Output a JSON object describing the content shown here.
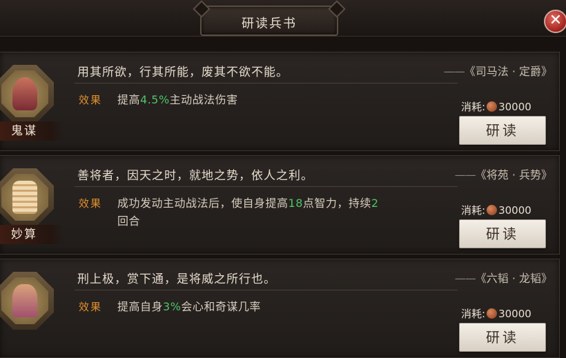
{
  "window": {
    "title": "研读兵书",
    "close_symbol": "✕"
  },
  "cost_label": "消耗:",
  "entries": [
    {
      "name": "鬼谋",
      "quote": "用其所欲，行其所能，废其不欲不能。",
      "source": "《司马法 · 定爵》",
      "effect_label": "效果",
      "effect_pre": "提高",
      "effect_highlight": "4.5%",
      "effect_post": "主动战法伤害",
      "cost_value": "30000",
      "button": "研读",
      "icon": "ghost-hand-icon"
    },
    {
      "name": "妙算",
      "quote": "善将者，因天之时，就地之势，依人之利。",
      "source": "《将苑 · 兵势》",
      "effect_label": "效果",
      "effect_pre": "成功发动主动战法后，使自身提高",
      "effect_highlight": "18",
      "effect_mid": "点智力，持续",
      "effect_highlight2": "2",
      "effect_post": "回合",
      "cost_value": "30000",
      "button": "研读",
      "icon": "scroll-icon"
    },
    {
      "name": "",
      "quote": "刑上极，赏下通，是将威之所行也。",
      "source": "《六韬 · 龙韬》",
      "effect_label": "效果",
      "effect_pre": "提高自身",
      "effect_highlight": "3%",
      "effect_post": "会心和奇谋几率",
      "cost_value": "30000",
      "button": "研读",
      "icon": "general-figure-icon"
    }
  ],
  "colors": {
    "highlight": "#4fc36a",
    "effect_label": "#e0902e",
    "close": "#a3221c"
  }
}
